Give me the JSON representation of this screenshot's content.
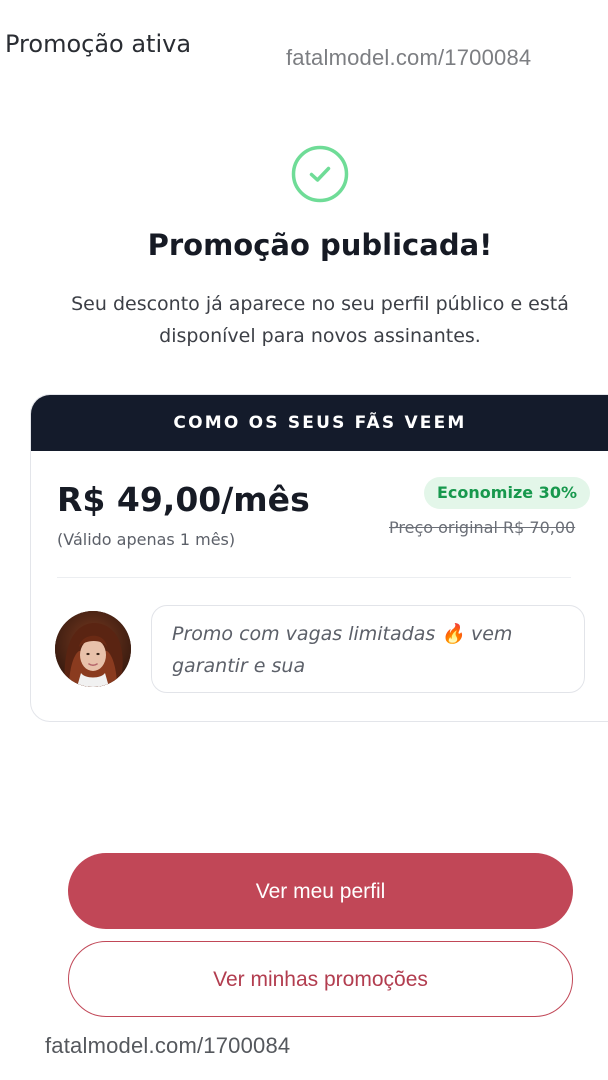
{
  "header": {
    "title": "Promoção ativa",
    "watermark": "fatalmodel.com/1700084"
  },
  "success": {
    "icon": "check-circle-icon",
    "accent_color": "#6fdc97",
    "heading": "Promoção publicada!",
    "description": "Seu desconto já aparece no seu perfil público e está disponível para novos assinantes."
  },
  "preview": {
    "header_label": "COMO OS SEUS FÃS VEEM",
    "price": "R$ 49,00/mês",
    "validity": "(Válido apenas 1 mês)",
    "discount_badge": "Economize 30%",
    "original_price": "Preço original R$ 70,00",
    "message": "Promo com vagas limitadas 🔥 vem garantir e sua"
  },
  "actions": {
    "primary_label": "Ver meu perfil",
    "secondary_label": "Ver minhas promoções",
    "brand_color": "#c14757"
  },
  "footer": {
    "watermark": "fatalmodel.com/1700084"
  }
}
